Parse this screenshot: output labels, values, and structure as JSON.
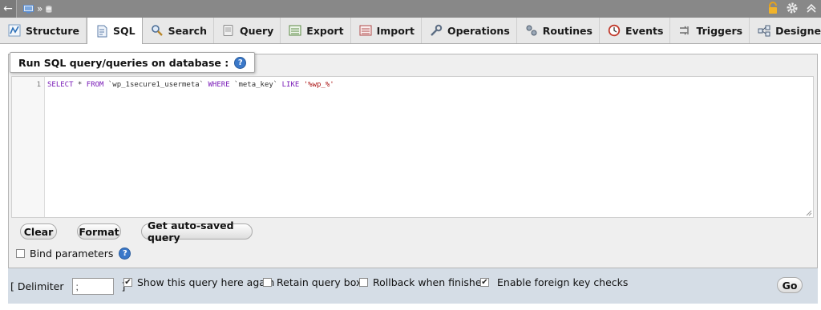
{
  "tabs": [
    {
      "label": "Structure",
      "icon": "structure-icon"
    },
    {
      "label": "SQL",
      "icon": "sql-icon",
      "active": true
    },
    {
      "label": "Search",
      "icon": "search-icon"
    },
    {
      "label": "Query",
      "icon": "query-icon"
    },
    {
      "label": "Export",
      "icon": "export-icon"
    },
    {
      "label": "Import",
      "icon": "import-icon"
    },
    {
      "label": "Operations",
      "icon": "wrench-icon"
    },
    {
      "label": "Routines",
      "icon": "routines-icon"
    },
    {
      "label": "Events",
      "icon": "clock-icon"
    },
    {
      "label": "Triggers",
      "icon": "triggers-icon"
    },
    {
      "label": "Designer",
      "icon": "designer-icon"
    }
  ],
  "panel": {
    "legend": "Run SQL query/queries on database :",
    "help_symbol": "?",
    "line_number": "1",
    "query": {
      "select": "SELECT",
      "star": " * ",
      "from": "FROM",
      "table": " `wp_1secure1_usermeta` ",
      "where": "WHERE",
      "column": " `meta_key` ",
      "like": "LIKE",
      "value": " '%wp_%'"
    },
    "buttons": {
      "clear": "Clear",
      "format": "Format",
      "autosaved": "Get auto-saved query"
    },
    "bind_parameters": "Bind parameters"
  },
  "bottom": {
    "delimiter_open": "[ Delimiter",
    "delimiter_value": ";",
    "delimiter_close": "]",
    "show_query": {
      "label": "Show this query here again",
      "checked": true
    },
    "retain_box": {
      "label": "Retain query box",
      "checked": false
    },
    "rollback": {
      "label": "Rollback when finished",
      "checked": false
    },
    "foreign_keys": {
      "label": "Enable foreign key checks",
      "checked": true
    },
    "go": "Go",
    "check_mark": "✔"
  },
  "colors": {
    "topbar": "#888888",
    "keyword": "#7a1cb8",
    "string": "#aa1111",
    "bottom_bar": "#d5dde6"
  }
}
